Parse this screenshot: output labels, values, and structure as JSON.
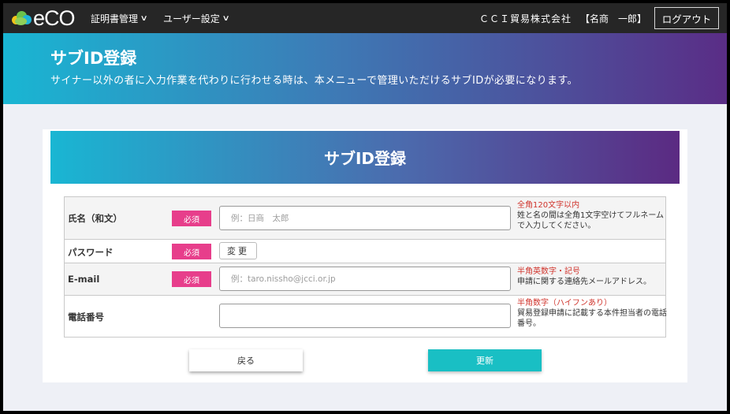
{
  "topbar": {
    "logo_text": "eCO",
    "nav": [
      {
        "label": "証明書管理",
        "icon": "chevron-down-icon"
      },
      {
        "label": "ユーザー設定",
        "icon": "chevron-down-icon"
      }
    ],
    "company": "ＣＣＩ貿易株式会社",
    "user": "【名商　一郎】",
    "logout_label": "ログアウト"
  },
  "hero": {
    "title": "サブID登録",
    "description": "サイナー以外の者に入力作業を代わりに行わせる時は、本メニューで管理いただけるサブIDが必要になります。"
  },
  "form": {
    "header": "サブID登録",
    "required_label": "必須",
    "rows": [
      {
        "label": "氏名（和文）",
        "required": true,
        "placeholder": "例：日商　太郎",
        "note_red": "全角120文字以内",
        "note": "姓と名の間は全角1文字空けてフルネームで入力してください。"
      },
      {
        "label": "パスワード",
        "required": true,
        "button_label": "変更"
      },
      {
        "label": "E-mail",
        "required": true,
        "placeholder": "例：taro.nissho@jcci.or.jp",
        "note_red": "半角英数字・記号",
        "note": "申請に関する連絡先メールアドレス。"
      },
      {
        "label": "電話番号",
        "required": false,
        "placeholder": "",
        "note_red": "半角数字（ハイフンあり）",
        "note": "貿易登録申請に記載する本件担当者の電話番号。"
      }
    ],
    "back_label": "戻る",
    "update_label": "更新"
  },
  "colors": {
    "topbar": "#262626",
    "required_badge": "#e73e8b",
    "update_button": "#19bfc4",
    "note_red": "#d0342c"
  }
}
